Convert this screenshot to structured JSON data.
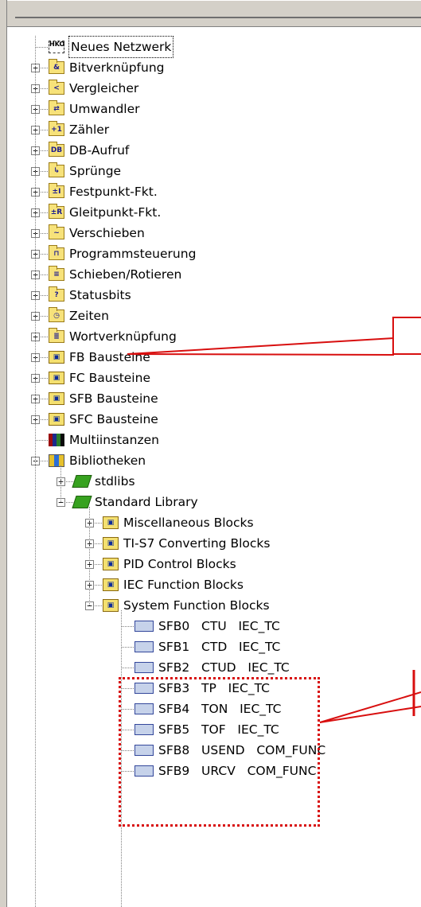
{
  "tree": {
    "items": [
      {
        "label": "Neues Netzwerk",
        "icon": "network-icon",
        "level": 1,
        "expander": "",
        "selected": true
      },
      {
        "label": "Bitverknüpfung",
        "icon": "bit-logic-icon",
        "glyph": "&",
        "level": 1,
        "expander": "+"
      },
      {
        "label": "Vergleicher",
        "icon": "comparator-icon",
        "glyph": "<",
        "level": 1,
        "expander": "+"
      },
      {
        "label": "Umwandler",
        "icon": "converter-icon",
        "glyph": "⇄",
        "level": 1,
        "expander": "+"
      },
      {
        "label": "Zähler",
        "icon": "counter-icon",
        "glyph": "+1",
        "level": 1,
        "expander": "+"
      },
      {
        "label": "DB-Aufruf",
        "icon": "db-call-icon",
        "glyph": "DB",
        "level": 1,
        "expander": "+"
      },
      {
        "label": "Sprünge",
        "icon": "jump-icon",
        "glyph": "↳",
        "level": 1,
        "expander": "+"
      },
      {
        "label": "Festpunkt-Fkt.",
        "icon": "fixed-point-icon",
        "glyph": "±I",
        "level": 1,
        "expander": "+"
      },
      {
        "label": "Gleitpunkt-Fkt.",
        "icon": "floating-point-icon",
        "glyph": "±R",
        "level": 1,
        "expander": "+"
      },
      {
        "label": "Verschieben",
        "icon": "move-icon",
        "glyph": "~",
        "level": 1,
        "expander": "+"
      },
      {
        "label": "Programmsteuerung",
        "icon": "program-control-icon",
        "glyph": "⊓",
        "level": 1,
        "expander": "+"
      },
      {
        "label": "Schieben/Rotieren",
        "icon": "shift-rotate-icon",
        "glyph": "≡",
        "level": 1,
        "expander": "+"
      },
      {
        "label": "Statusbits",
        "icon": "status-bits-icon",
        "glyph": "?",
        "level": 1,
        "expander": "+"
      },
      {
        "label": "Zeiten",
        "icon": "timer-icon",
        "glyph": "◷",
        "level": 1,
        "expander": "+"
      },
      {
        "label": "Wortverknüpfung",
        "icon": "word-logic-icon",
        "glyph": "≣",
        "level": 1,
        "expander": "+"
      },
      {
        "label": "FB Bausteine",
        "icon": "fb-block-icon",
        "glyph": "▣",
        "level": 1,
        "expander": "+"
      },
      {
        "label": "FC Bausteine",
        "icon": "fc-block-icon",
        "glyph": "▣",
        "level": 1,
        "expander": "+"
      },
      {
        "label": "SFB Bausteine",
        "icon": "sfb-block-icon",
        "glyph": "▣",
        "level": 1,
        "expander": "+"
      },
      {
        "label": "SFC Bausteine",
        "icon": "sfc-block-icon",
        "glyph": "▣",
        "level": 1,
        "expander": "+"
      },
      {
        "label": "Multiinstanzen",
        "icon": "multi-instance-icon",
        "level": 1,
        "expander": ""
      },
      {
        "label": "Bibliotheken",
        "icon": "libraries-icon",
        "level": 1,
        "expander": "−"
      },
      {
        "label": "stdlibs",
        "icon": "library-book-icon",
        "level": 2,
        "expander": "+"
      },
      {
        "label": "Standard Library",
        "icon": "library-book-icon",
        "level": 2,
        "expander": "−"
      },
      {
        "label": "Miscellaneous Blocks",
        "icon": "block-folder-icon",
        "glyph": "▣",
        "level": 3,
        "expander": "+"
      },
      {
        "label": "TI-S7 Converting Blocks",
        "icon": "block-folder-icon",
        "glyph": "▣",
        "level": 3,
        "expander": "+"
      },
      {
        "label": "PID Control Blocks",
        "icon": "block-folder-icon",
        "glyph": "▣",
        "level": 3,
        "expander": "+"
      },
      {
        "label": "IEC Function Blocks",
        "icon": "block-folder-icon",
        "glyph": "▣",
        "level": 3,
        "expander": "+"
      },
      {
        "label": "System Function Blocks",
        "icon": "block-folder-icon",
        "glyph": "▣",
        "level": 3,
        "expander": "−"
      },
      {
        "label": "SFB0   CTU   IEC_TC",
        "icon": "sfb-icon",
        "level": 4,
        "expander": ""
      },
      {
        "label": "SFB1   CTD   IEC_TC",
        "icon": "sfb-icon",
        "level": 4,
        "expander": ""
      },
      {
        "label": "SFB2   CTUD   IEC_TC",
        "icon": "sfb-icon",
        "level": 4,
        "expander": ""
      },
      {
        "label": "SFB3   TP   IEC_TC",
        "icon": "sfb-icon",
        "level": 4,
        "expander": ""
      },
      {
        "label": "SFB4   TON   IEC_TC",
        "icon": "sfb-icon",
        "level": 4,
        "expander": ""
      },
      {
        "label": "SFB5   TOF   IEC_TC",
        "icon": "sfb-icon",
        "level": 4,
        "expander": ""
      },
      {
        "label": "SFB8   USEND   COM_FUNC",
        "icon": "sfb-icon",
        "level": 4,
        "expander": ""
      },
      {
        "label": "SFB9   URCV   COM_FUNC",
        "icon": "sfb-icon",
        "level": 4,
        "expander": ""
      }
    ]
  },
  "colors": {
    "annotation": "#d80f0f",
    "selection_text": "#0000ff",
    "frame": "#d4d0c8"
  }
}
